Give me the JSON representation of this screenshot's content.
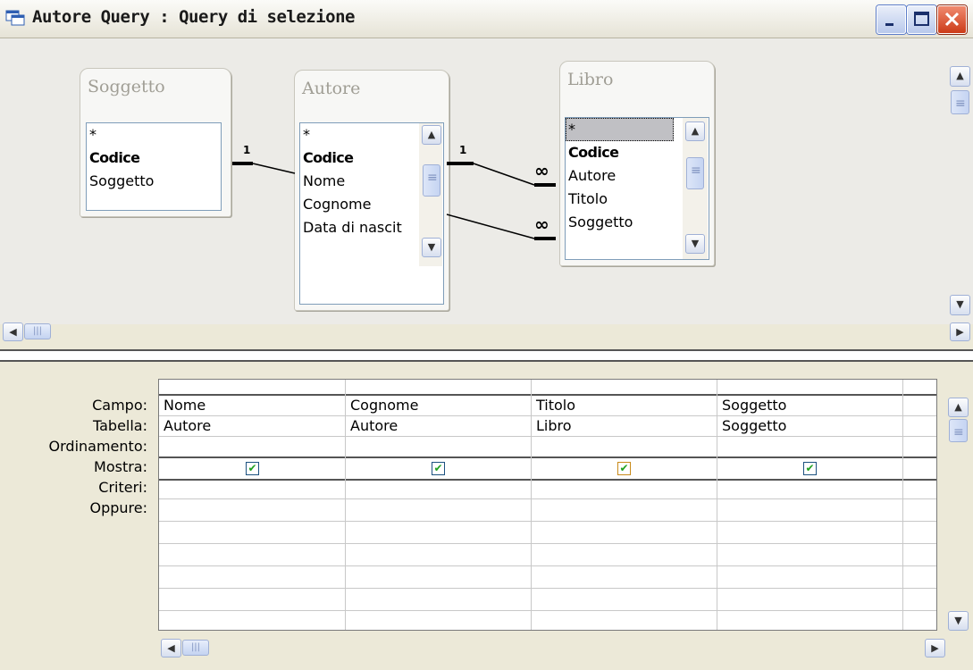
{
  "window": {
    "title": "Autore Query : Query di selezione",
    "icons": {
      "app": "query-window-icon",
      "minimize": "minimize-icon",
      "maximize": "maximize-icon",
      "close": "close-icon"
    }
  },
  "tables": [
    {
      "name": "Soggetto",
      "fields": [
        {
          "label": "*",
          "key": false
        },
        {
          "label": "Codice",
          "key": true
        },
        {
          "label": "Soggetto",
          "key": false
        }
      ]
    },
    {
      "name": "Autore",
      "fields": [
        {
          "label": "*",
          "key": false
        },
        {
          "label": "Codice",
          "key": true
        },
        {
          "label": "Nome",
          "key": false
        },
        {
          "label": "Cognome",
          "key": false
        },
        {
          "label": "Data di nascit",
          "key": false
        }
      ]
    },
    {
      "name": "Libro",
      "fields": [
        {
          "label": "*",
          "key": false
        },
        {
          "label": "Codice",
          "key": true
        },
        {
          "label": "Autore",
          "key": false
        },
        {
          "label": "Titolo",
          "key": false
        },
        {
          "label": "Soggetto",
          "key": false
        }
      ]
    }
  ],
  "relationships": [
    {
      "one": "1",
      "many": ""
    },
    {
      "one": "1",
      "many": "∞"
    },
    {
      "one": "",
      "many": "∞"
    }
  ],
  "grid": {
    "row_labels": [
      "Campo:",
      "Tabella:",
      "Ordinamento:",
      "Mostra:",
      "Criteri:",
      "Oppure:"
    ],
    "columns": [
      {
        "campo": "Nome",
        "tabella": "Autore",
        "ordinamento": "",
        "mostra": true
      },
      {
        "campo": "Cognome",
        "tabella": "Autore",
        "ordinamento": "",
        "mostra": true
      },
      {
        "campo": "Titolo",
        "tabella": "Libro",
        "ordinamento": "",
        "mostra": true
      },
      {
        "campo": "Soggetto",
        "tabella": "Soggetto",
        "ordinamento": "",
        "mostra": true
      }
    ],
    "check_glyph": "✔"
  },
  "scroll_icons": {
    "up": "▲",
    "down": "▼",
    "left": "◀",
    "right": "▶",
    "grip": "|||"
  },
  "colors": {
    "accent": "#0a246a",
    "check": "#21a121"
  }
}
